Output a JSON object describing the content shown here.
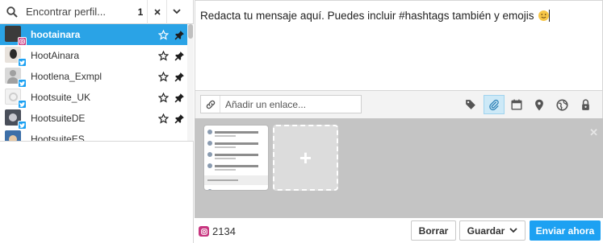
{
  "search": {
    "placeholder": "Encontrar perfil...",
    "selected_count": "1",
    "clear_icon": "close-icon",
    "expand_icon": "chevron-down-icon"
  },
  "profiles": [
    {
      "name": "hootainara",
      "network": "instagram",
      "active": true
    },
    {
      "name": "HootAinara",
      "network": "twitter",
      "active": false
    },
    {
      "name": "Hootlena_Exmpl",
      "network": "twitter",
      "active": false
    },
    {
      "name": "Hootsuite_UK",
      "network": "twitter",
      "active": false
    },
    {
      "name": "HootsuiteDE",
      "network": "twitter",
      "active": false
    },
    {
      "name": "HootsuiteES",
      "network": "twitter",
      "active": false
    }
  ],
  "composer": {
    "message": "Redacta tu mensaje aquí. Puedes incluir #hashtags también y emojis",
    "emoji": "slightly-smiling-face"
  },
  "link": {
    "placeholder": "Añadir un enlace..."
  },
  "toolbar": {
    "icons": [
      "tag-icon",
      "attachment-icon",
      "calendar-icon",
      "location-icon",
      "targeting-icon",
      "privacy-lock-icon"
    ],
    "active": "attachment-icon"
  },
  "media": {
    "close_icon": "close-icon",
    "add_icon": "plus-icon"
  },
  "footer": {
    "character_count": "2134",
    "delete_label": "Borrar",
    "save_label": "Guardar",
    "send_label": "Enviar ahora"
  },
  "colors": {
    "accent": "#2aa3e6",
    "primary_button": "#1da1f2",
    "instagram": "#c7357f",
    "twitter": "#1da1f2"
  }
}
